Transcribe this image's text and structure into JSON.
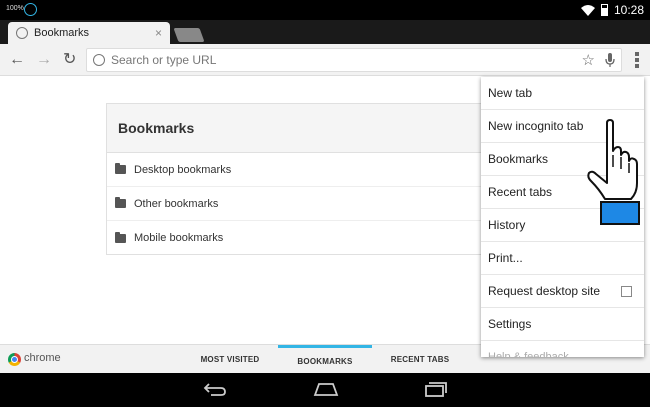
{
  "status_bar": {
    "left_text": "100%",
    "time": "10:28",
    "icons": [
      "notification-icon",
      "wifi-icon",
      "battery-icon"
    ]
  },
  "tab": {
    "title": "Bookmarks",
    "close_glyph": "×"
  },
  "toolbar": {
    "back_glyph": "←",
    "forward_glyph": "→",
    "reload_glyph": "↻",
    "omnibox_placeholder": "Search or type URL",
    "omnibox_value": "",
    "star_glyph": "☆",
    "mic_glyph": "🎙"
  },
  "bookmarks": {
    "header": "Bookmarks",
    "items": [
      {
        "label": "Desktop bookmarks"
      },
      {
        "label": "Other bookmarks"
      },
      {
        "label": "Mobile bookmarks"
      }
    ]
  },
  "bottom_bar": {
    "brand": "chrome",
    "tabs": [
      {
        "label": "MOST VISITED",
        "active": false
      },
      {
        "label": "BOOKMARKS",
        "active": true
      },
      {
        "label": "RECENT TABS",
        "active": false
      }
    ]
  },
  "menu": {
    "items": [
      {
        "label": "New tab"
      },
      {
        "label": "New incognito tab"
      },
      {
        "label": "Bookmarks"
      },
      {
        "label": "Recent tabs"
      },
      {
        "label": "History"
      },
      {
        "label": "Print..."
      },
      {
        "label": "Request desktop site",
        "checkbox": true,
        "checked": false
      },
      {
        "label": "Settings"
      },
      {
        "label": "Help & feedback"
      }
    ]
  },
  "nav_bar": {
    "back_glyph": "↩",
    "home_glyph": "⌂",
    "recents_glyph": "▭"
  },
  "colors": {
    "accent": "#33b5e5",
    "hand_cuff": "#1e88e5"
  }
}
